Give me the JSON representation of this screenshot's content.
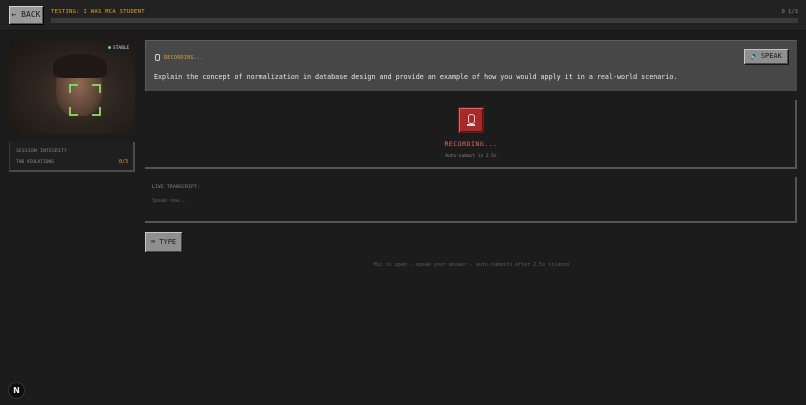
{
  "header": {
    "back_label": "← BACK",
    "testing_label": "TESTING: I WAS MCA STUDENT",
    "question_counter": "0 1/3",
    "progress_fraction": 0
  },
  "webcam": {
    "status_label": "STABLE",
    "status_color": "#6fd04a"
  },
  "integrity": {
    "title": "SESSION INTEGRITY",
    "tab_violations_label": "TAB VIOLATIONS",
    "tab_violations_value": "0/3"
  },
  "question": {
    "recording_label": "RECORDING...",
    "speak_label": "SPEAK",
    "speak_icon": "speaker-icon",
    "text": "Explain the concept of normalization in database design and provide an example of how you would apply it in a real-world scenario."
  },
  "recorder": {
    "button_icon": "microphone-icon",
    "status": "RECORDING...",
    "autosubmit": "Auto-submit in 2.5s",
    "accent_color": "#a52a2a"
  },
  "transcript": {
    "title": "LIVE TRANSCRIPT:",
    "placeholder": "Speak now..."
  },
  "type_button": {
    "label": "⌨ TYPE"
  },
  "hint": "Mic is open - speak your answer - auto-submits after 2.5s silence",
  "dev_badge": {
    "label": "N"
  }
}
